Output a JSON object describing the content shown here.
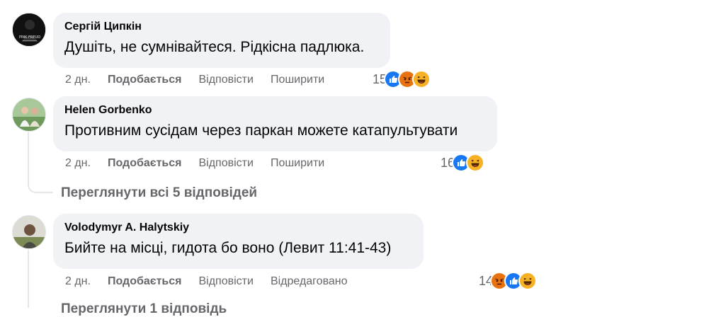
{
  "comments": [
    {
      "author": "Сергій Ципкін",
      "text": "Душіть, не сумнівайтеся. Рідкісна падлюка.",
      "time": "2 дн.",
      "like": "Подобається",
      "reply": "Відповісти",
      "share": "Поширити",
      "count": "15",
      "reactions": [
        "like",
        "angry",
        "haha"
      ],
      "avatar_text": "PINK FREUD"
    },
    {
      "author": "Helen Gorbenko",
      "text": "Противним сусідам через паркан можете катапультувати",
      "time": "2 дн.",
      "like": "Подобається",
      "reply": "Відповісти",
      "share": "Поширити",
      "count": "16",
      "reactions": [
        "like",
        "haha"
      ]
    },
    {
      "author": "Volodymyr A. Halytskiy",
      "text": "Бийте на місці, гидота бо воно (Левит 11:41-43)",
      "time": "2 дн.",
      "like": "Подобається",
      "reply": "Відповісти",
      "edited": "Відредаговано",
      "count": "14",
      "reactions": [
        "angry",
        "like",
        "haha"
      ]
    }
  ],
  "view_replies": "Переглянути всі 5 відповідей",
  "view_more_partial": "Переглянути 1 відповідь",
  "colors": {
    "bubble": "#f0f2f5",
    "secondary": "#65676b",
    "like_blue": "#1877f2",
    "angry_orange": "#e9710f",
    "haha_yellow": "#f7b125"
  }
}
